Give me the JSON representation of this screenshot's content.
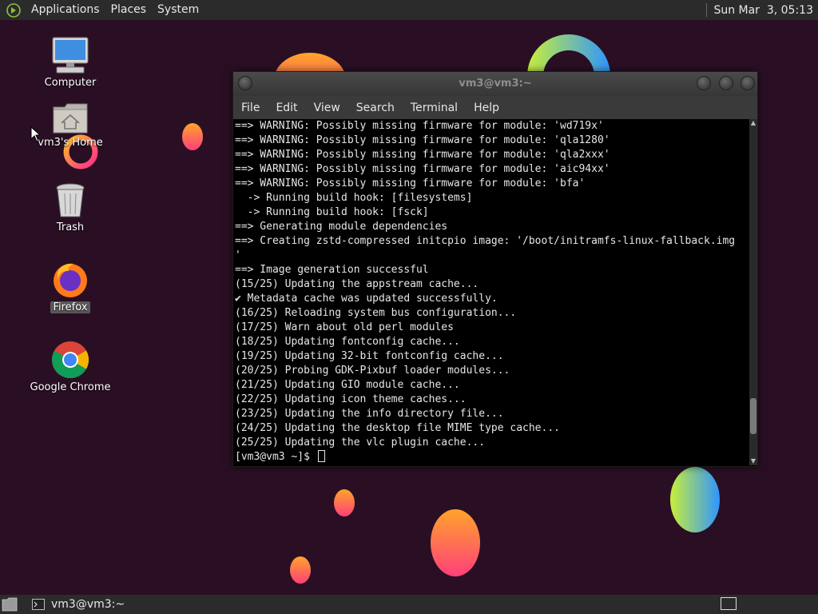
{
  "top_panel": {
    "menus": [
      {
        "label": "Applications"
      },
      {
        "label": "Places"
      },
      {
        "label": "System"
      }
    ],
    "clock": "Sun Mar  3, 05:13"
  },
  "desktop": {
    "icons": [
      {
        "label": "Computer",
        "icon": "computer-icon"
      },
      {
        "label": "vm3's Home",
        "icon": "home-folder-icon"
      },
      {
        "label": "Trash",
        "icon": "trash-icon"
      },
      {
        "label": "Firefox",
        "icon": "firefox-icon",
        "selected": true
      },
      {
        "label": "Google Chrome",
        "icon": "chrome-icon"
      }
    ]
  },
  "terminal": {
    "title": "vm3@vm3:~",
    "menus": [
      {
        "label": "File"
      },
      {
        "label": "Edit"
      },
      {
        "label": "View"
      },
      {
        "label": "Search"
      },
      {
        "label": "Terminal"
      },
      {
        "label": "Help"
      }
    ],
    "lines": [
      "==> WARNING: Possibly missing firmware for module: 'wd719x'",
      "==> WARNING: Possibly missing firmware for module: 'qla1280'",
      "==> WARNING: Possibly missing firmware for module: 'qla2xxx'",
      "==> WARNING: Possibly missing firmware for module: 'aic94xx'",
      "==> WARNING: Possibly missing firmware for module: 'bfa'",
      "  -> Running build hook: [filesystems]",
      "  -> Running build hook: [fsck]",
      "==> Generating module dependencies",
      "==> Creating zstd-compressed initcpio image: '/boot/initramfs-linux-fallback.img",
      "'",
      "==> Image generation successful",
      "(15/25) Updating the appstream cache...",
      "✔ Metadata cache was updated successfully.",
      "(16/25) Reloading system bus configuration...",
      "(17/25) Warn about old perl modules",
      "(18/25) Updating fontconfig cache...",
      "(19/25) Updating 32-bit fontconfig cache...",
      "(20/25) Probing GDK-Pixbuf loader modules...",
      "(21/25) Updating GIO module cache...",
      "(22/25) Updating icon theme caches...",
      "(23/25) Updating the info directory file...",
      "(24/25) Updating the desktop file MIME type cache...",
      "(25/25) Updating the vlc plugin cache..."
    ],
    "prompt": "[vm3@vm3 ~]$ ",
    "scroll_position": 0.92
  },
  "bottom_panel": {
    "task_label": "vm3@vm3:~"
  },
  "colors": {
    "panel": "#2b2b2b",
    "wallpaper": "#2a0f24",
    "terminal_bg": "#000000",
    "terminal_text": "#e6e6e6"
  }
}
